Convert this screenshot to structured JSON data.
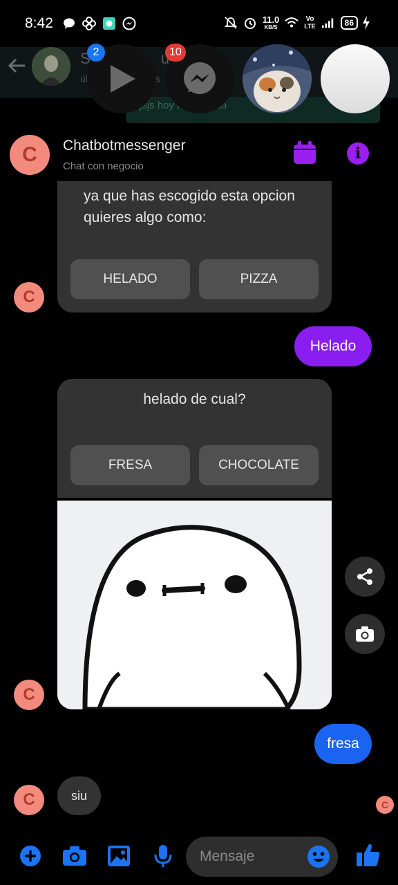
{
  "status_bar": {
    "time": "8:42",
    "net_speed_value": "11.0",
    "net_speed_unit": "KB/S",
    "network_label_top": "Vo",
    "network_label_bottom": "LTE",
    "battery": "86"
  },
  "background_chat": {
    "name": "S",
    "name_partial": "ue)",
    "subtitle": "úl",
    "subtitle_partial": "s",
    "preview": "jsjs hoy  nacia     ncito"
  },
  "chat_heads": {
    "video_badge": "2",
    "messenger_badge": "10"
  },
  "chat": {
    "name": "Chatbotmessenger",
    "subtitle": "Chat con negocio",
    "avatar_letter": "C",
    "messages": {
      "card1_text": "ya que has escogido esta opcion quieres algo como:",
      "card1_options": [
        "HELADO",
        "PIZZA"
      ],
      "sent_1": "Helado",
      "card2_text": "helado de cual?",
      "card2_options": [
        "FRESA",
        "CHOCOLATE"
      ],
      "sent_2": "fresa",
      "received_last": "siu"
    }
  },
  "composer": {
    "placeholder": "Mensaje"
  },
  "colors": {
    "accent_purple": "#8a1ef0",
    "accent_blue": "#1b64f2",
    "avatar_bg": "#f28b7e",
    "bubble_gray": "#333333"
  },
  "icons": [
    "add-icon",
    "camera-icon",
    "gallery-icon",
    "microphone-icon",
    "emoji-icon",
    "like-icon",
    "share-icon",
    "calendar-icon",
    "info-icon"
  ]
}
